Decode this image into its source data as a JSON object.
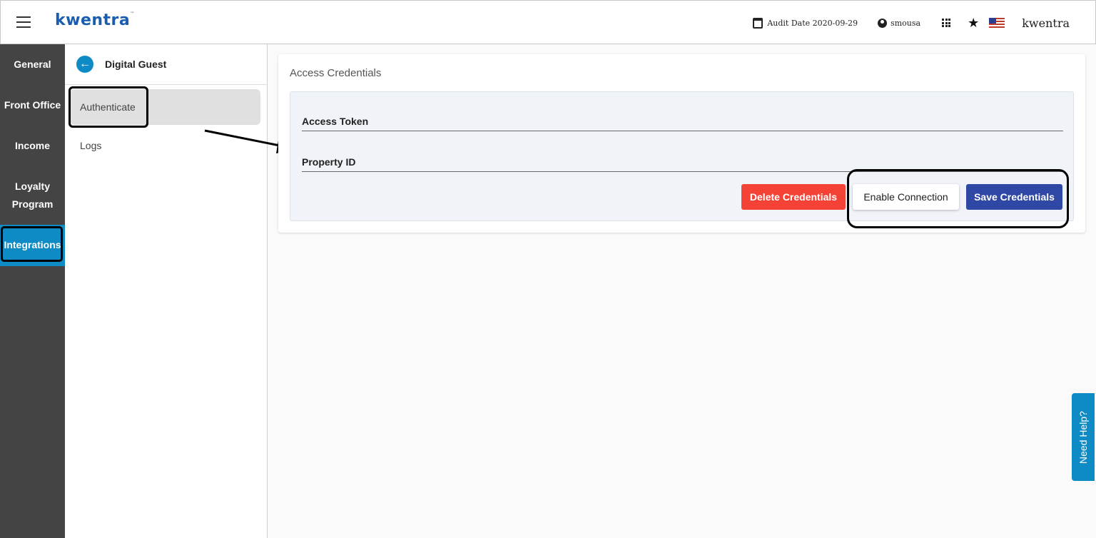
{
  "header": {
    "logo": "kwentra",
    "audit_date": "Audit Date 2020-09-29",
    "username": "smousa",
    "brand_name": "kwentra"
  },
  "leftnav": {
    "items": [
      {
        "label": "General"
      },
      {
        "label": "Front Office"
      },
      {
        "label": "Income"
      },
      {
        "label": "Loyalty Program"
      },
      {
        "label": "Integrations"
      }
    ]
  },
  "subnav": {
    "title": "Digital Guest",
    "items": [
      {
        "label": "Authenticate"
      },
      {
        "label": "Logs"
      }
    ]
  },
  "main": {
    "card_title": "Access Credentials",
    "fields": [
      {
        "label": "Access Token"
      },
      {
        "label": "Property ID"
      }
    ],
    "buttons": {
      "delete": "Delete Credentials",
      "enable": "Enable Connection",
      "save": "Save Credentials"
    }
  },
  "help": {
    "label": "Need Help?"
  },
  "colors": {
    "accent": "#0e8bc4",
    "sidebar": "#444444",
    "danger": "#f44336",
    "primary": "#2f48a6"
  }
}
